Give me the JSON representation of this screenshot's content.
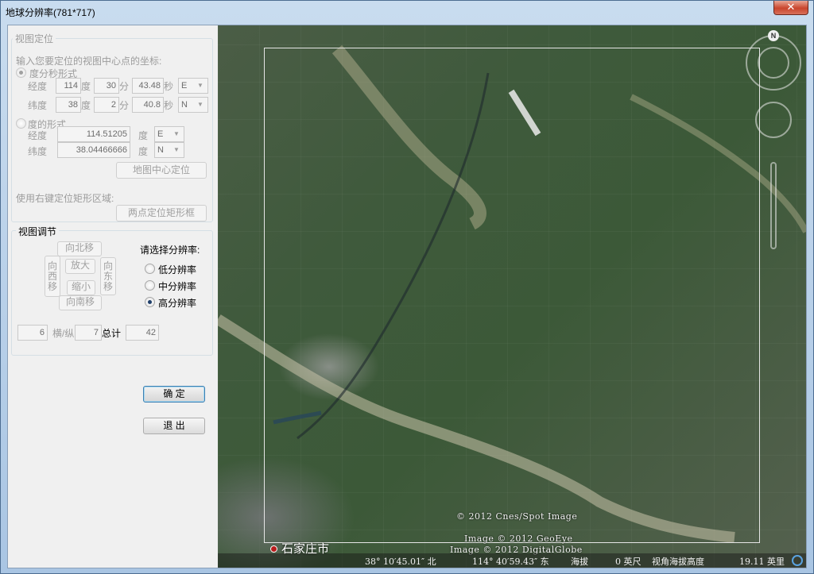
{
  "window": {
    "title": "地球分辨率(781*717)",
    "close": "✕"
  },
  "view_locate": {
    "group_title": "视图定位",
    "prompt": "输入您要定位的视图中心点的坐标:",
    "dms_option": "度分秒形式",
    "lon_label": "经度",
    "lat_label": "纬度",
    "lon_deg": "114",
    "lon_min": "30",
    "lon_sec": "43.48",
    "lon_dir": "E",
    "lat_deg": "38",
    "lat_min": "2",
    "lat_sec": "40.8",
    "lat_dir": "N",
    "deg_unit": "度",
    "min_unit": "分",
    "sec_unit": "秒",
    "decimal_option": "度的形式",
    "lon_decimal": "114.51205",
    "lat_decimal": "38.04466666",
    "lon_decimal_dir": "E",
    "lat_decimal_dir": "N",
    "locate_button": "地图中心定位",
    "rect_prompt": "使用右键定位矩形区域:",
    "rect_button": "两点定位矩形框"
  },
  "view_adjust": {
    "group_title": "视图调节",
    "north": "向北移",
    "south": "向南移",
    "west": "向西移",
    "east": "向东移",
    "zoom_in": "放大",
    "zoom_out": "缩小",
    "resolution_prompt": "请选择分辨率:",
    "res_low": "低分辨率",
    "res_mid": "中分辨率",
    "res_high": "高分辨率",
    "selected_resolution": "高分辨率",
    "cols": "6",
    "cols_rows_label": "横/纵",
    "rows": "7",
    "total_label": "总计",
    "total": "42"
  },
  "actions": {
    "ok": "确  定",
    "exit": "退  出"
  },
  "map": {
    "credit1": "© 2012 Cnes/Spot Image",
    "credit2": "Image © 2012 GeoEye",
    "credit3": "Image © 2012 DigitalGlobe",
    "compass_n": "N",
    "place": "石家庄市",
    "status_lat": "38° 10′45.01″ 北",
    "status_lon": "114° 40′59.43″ 东",
    "status_alt_label": "海拔",
    "status_alt": "0 英尺",
    "status_view_label": "视角海拔高度",
    "status_view": "19.11 英里"
  },
  "colors": {
    "title_bar": "#c9dcef",
    "close": "#c9452d",
    "map_green": "#3f5a3c"
  }
}
